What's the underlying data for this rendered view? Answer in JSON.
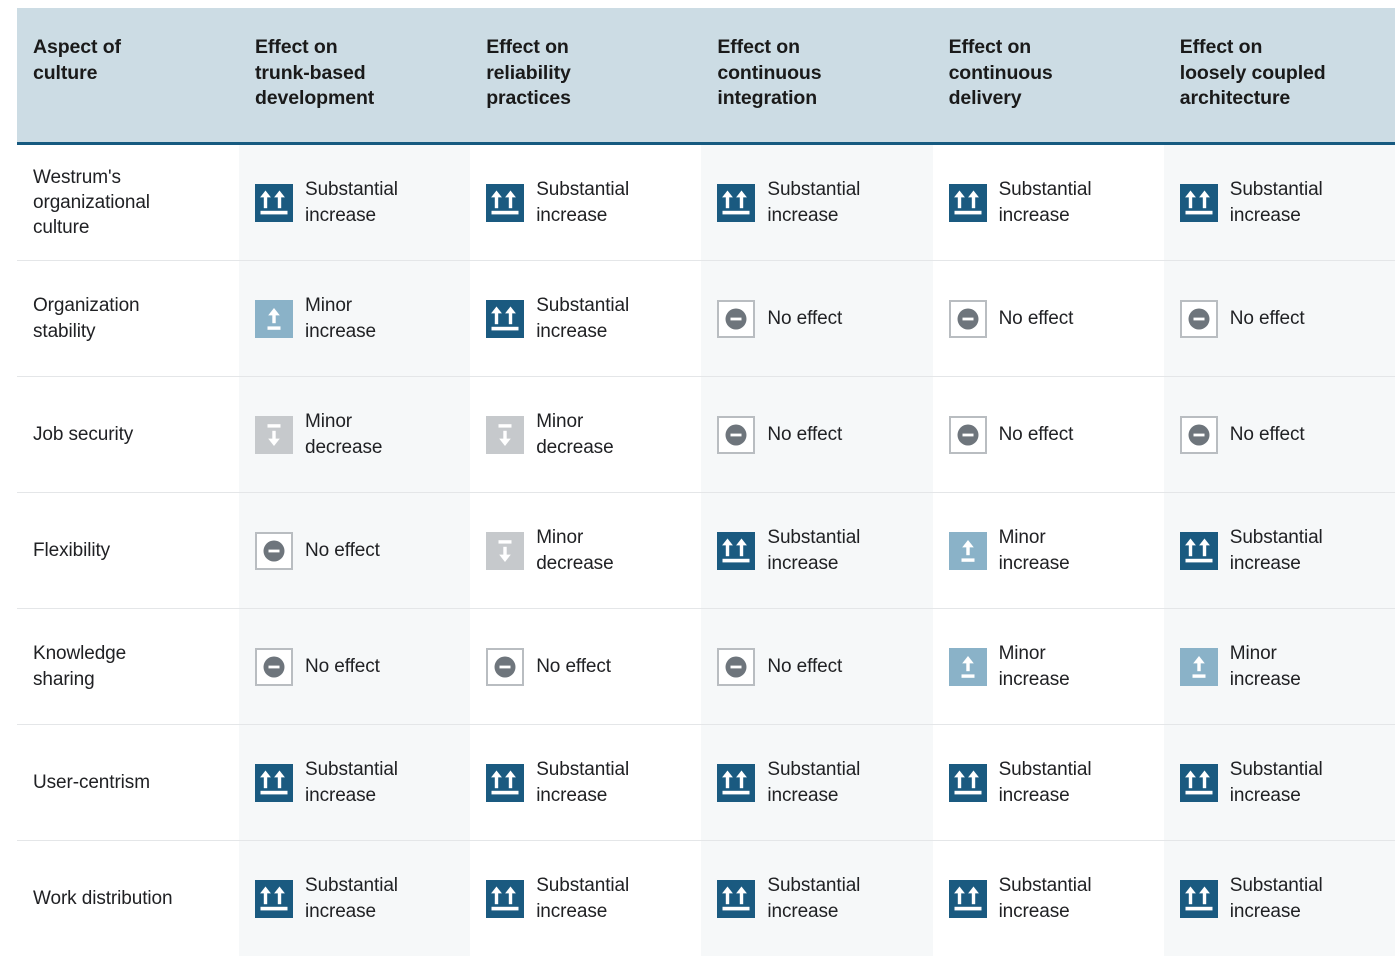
{
  "table": {
    "columns": [
      {
        "id": "aspect",
        "label": "Aspect of\nculture"
      },
      {
        "id": "trunk_based",
        "label": "Effect on\ntrunk-based\ndevelopment"
      },
      {
        "id": "reliability",
        "label": "Effect on\nreliability\npractices"
      },
      {
        "id": "continuous_integration",
        "label": "Effect on\ncontinuous\nintegration"
      },
      {
        "id": "continuous_delivery",
        "label": "Effect on\ncontinuous\ndelivery"
      },
      {
        "id": "loosely_coupled",
        "label": "Effect on\nloosely coupled\narchitecture"
      }
    ],
    "effect_types": {
      "substantial_increase": {
        "label": "Substantial\nincrease",
        "icon": "double-up-arrow-icon",
        "box_color": "#1a5a80",
        "mark_color": "#ffffff"
      },
      "minor_increase": {
        "label": "Minor\nincrease",
        "icon": "single-up-arrow-icon",
        "box_color": "#8ab2c8",
        "mark_color": "#ffffff"
      },
      "minor_decrease": {
        "label": "Minor\ndecrease",
        "icon": "single-down-arrow-icon",
        "box_color": "#c6c9cc",
        "mark_color": "#ffffff"
      },
      "no_effect": {
        "label": "No effect",
        "icon": "minus-circle-icon",
        "box_color": "#ffffff",
        "mark_color": "#6e757c"
      }
    },
    "rows": [
      {
        "aspect": "Westrum's\norganizational\nculture",
        "cells": [
          "substantial_increase",
          "substantial_increase",
          "substantial_increase",
          "substantial_increase",
          "substantial_increase"
        ]
      },
      {
        "aspect": "Organization\nstability",
        "cells": [
          "minor_increase",
          "substantial_increase",
          "no_effect",
          "no_effect",
          "no_effect"
        ]
      },
      {
        "aspect": "Job security",
        "cells": [
          "minor_decrease",
          "minor_decrease",
          "no_effect",
          "no_effect",
          "no_effect"
        ]
      },
      {
        "aspect": "Flexibility",
        "cells": [
          "no_effect",
          "minor_decrease",
          "substantial_increase",
          "minor_increase",
          "substantial_increase"
        ]
      },
      {
        "aspect": "Knowledge\nsharing",
        "cells": [
          "no_effect",
          "no_effect",
          "no_effect",
          "minor_increase",
          "minor_increase"
        ]
      },
      {
        "aspect": "User-centrism",
        "cells": [
          "substantial_increase",
          "substantial_increase",
          "substantial_increase",
          "substantial_increase",
          "substantial_increase"
        ]
      },
      {
        "aspect": "Work distribution",
        "cells": [
          "substantial_increase",
          "substantial_increase",
          "substantial_increase",
          "substantial_increase",
          "substantial_increase"
        ]
      }
    ]
  },
  "colors": {
    "header_background": "#ccdce4",
    "header_rule": "#165a80",
    "tinted_column": "#f6f8f9",
    "row_divider": "#e4e6e8",
    "text": "#202124"
  }
}
